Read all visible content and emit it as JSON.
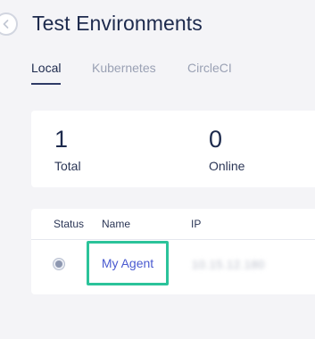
{
  "header": {
    "title": "Test Environments"
  },
  "tabs": [
    {
      "label": "Local"
    },
    {
      "label": "Kubernetes"
    },
    {
      "label": "CircleCI"
    }
  ],
  "stats": {
    "total": {
      "value": "1",
      "label": "Total"
    },
    "online": {
      "value": "0",
      "label": "Online"
    }
  },
  "table": {
    "columns": [
      "Status",
      "Name",
      "IP"
    ],
    "rows": [
      {
        "status": "offline",
        "name": "My Agent",
        "ip": "10.15.12.180"
      }
    ]
  },
  "colors": {
    "highlight": "#2bc39a",
    "link": "#4a5ad0",
    "title": "#1d2a4d",
    "tab_inactive": "#9aa1b4"
  },
  "icons": {
    "collapse": "chevron-left-icon"
  }
}
